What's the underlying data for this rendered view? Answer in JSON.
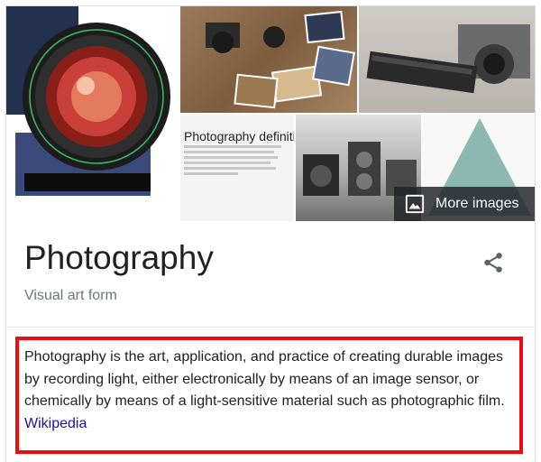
{
  "images": [
    {
      "name": "camera-lens-image"
    },
    {
      "name": "camera-prints-desk-image"
    },
    {
      "name": "film-camera-image"
    },
    {
      "name": "photography-definition-image",
      "title": "Photography definitio"
    },
    {
      "name": "vintage-cameras-image"
    },
    {
      "name": "exposure-triangle-image"
    }
  ],
  "more_images": {
    "label": "More images",
    "icon": "image-icon"
  },
  "entity": {
    "title": "Photography",
    "subtitle": "Visual art form",
    "share_icon": "share-icon"
  },
  "description": {
    "text": "Photography is the art, application, and practice of creating durable images by recording light, either electronically by means of an image sensor, or chemically by means of a light-sensitive material such as photographic film.",
    "source_link": "Wikipedia"
  },
  "colors": {
    "highlight_border": "#ee0b12",
    "link": "#1a0dab",
    "title_text": "#202124",
    "subtitle_text": "#70757a"
  }
}
